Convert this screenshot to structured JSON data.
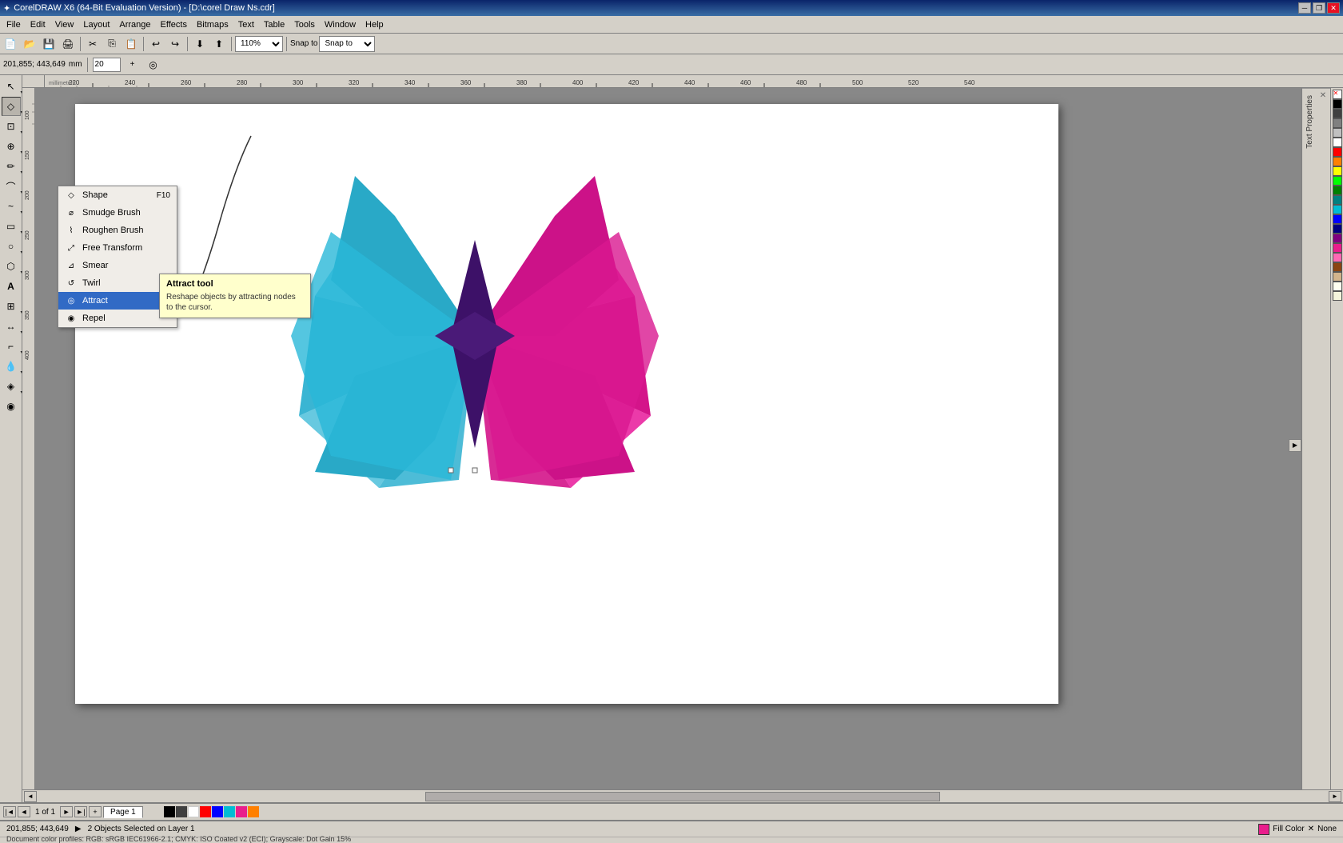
{
  "app": {
    "title": "CorelDRAW X6 (64-Bit Evaluation Version) - [D:\\corel Draw Ns.cdr]",
    "icon": "✦"
  },
  "titlebar": {
    "minimize": "─",
    "maximize": "□",
    "restore": "❐",
    "close": "✕",
    "restore_app": "❐",
    "minimize_app": "─"
  },
  "menu": {
    "items": [
      "File",
      "Edit",
      "View",
      "Layout",
      "Arrange",
      "Effects",
      "Bitmaps",
      "Text",
      "Table",
      "Tools",
      "Window",
      "Help"
    ]
  },
  "property_bar": {
    "coords": "201,855; 443,649",
    "width_label": "20",
    "snap_label": "Snap to",
    "zoom_level": "110%"
  },
  "toolbox": {
    "tools": [
      {
        "name": "select-tool",
        "icon": "↖",
        "active": false
      },
      {
        "name": "shape-tool",
        "icon": "◇",
        "active": true
      },
      {
        "name": "crop-tool",
        "icon": "⊡",
        "active": false
      },
      {
        "name": "zoom-tool",
        "icon": "🔍",
        "active": false
      },
      {
        "name": "freehand-tool",
        "icon": "✏",
        "active": false
      },
      {
        "name": "smart-draw",
        "icon": "⌒",
        "active": false
      },
      {
        "name": "artistic-media",
        "icon": "~",
        "active": false
      },
      {
        "name": "rectangle-tool",
        "icon": "▭",
        "active": false
      },
      {
        "name": "ellipse-tool",
        "icon": "○",
        "active": false
      },
      {
        "name": "polygon-tool",
        "icon": "⬡",
        "active": false
      },
      {
        "name": "text-tool",
        "icon": "A",
        "active": false
      },
      {
        "name": "table-tool",
        "icon": "⊞",
        "active": false
      },
      {
        "name": "dimension-tool",
        "icon": "↔",
        "active": false
      },
      {
        "name": "connector-tool",
        "icon": "⌐",
        "active": false
      },
      {
        "name": "color-dropper",
        "icon": "🔘",
        "active": false
      },
      {
        "name": "interactive-fill",
        "icon": "◈",
        "active": false
      },
      {
        "name": "smart-fill",
        "icon": "◉",
        "active": false
      }
    ]
  },
  "shape_dropdown": {
    "items": [
      {
        "name": "shape-item",
        "label": "Shape",
        "shortcut": "F10",
        "icon": "◇"
      },
      {
        "name": "smudge-item",
        "label": "Smudge Brush",
        "shortcut": "",
        "icon": "⌀"
      },
      {
        "name": "roughen-item",
        "label": "Roughen Brush",
        "shortcut": "",
        "icon": "⌇"
      },
      {
        "name": "free-transform-item",
        "label": "Free Transform",
        "shortcut": "",
        "icon": "⤢"
      },
      {
        "name": "smear-item",
        "label": "Smear",
        "shortcut": "",
        "icon": "⊿"
      },
      {
        "name": "twirl-item",
        "label": "Twirl",
        "shortcut": "",
        "icon": "⟳"
      },
      {
        "name": "attract-item",
        "label": "Attract",
        "shortcut": "",
        "icon": "◎",
        "selected": true
      },
      {
        "name": "repel-item",
        "label": "Repel",
        "shortcut": "",
        "icon": "◉"
      }
    ]
  },
  "tooltip": {
    "title": "Attract tool",
    "description": "Reshape objects by attracting nodes to the cursor."
  },
  "canvas": {
    "zoom": "110%",
    "page_number": "1",
    "page_total": "1",
    "page_name": "Page 1"
  },
  "status_bar": {
    "coords": "201,855; 443,649",
    "status": "2 Objects Selected on Layer 1",
    "fill_label": "Fill Color",
    "fill_color": "None",
    "profile": "Document color profiles: RGB: sRGB IEC61966-2.1; CMYK: ISO Coated v2 (ECI); Grayscale: Dot Gain 15%"
  },
  "colors": {
    "black": "#000000",
    "white": "#ffffff",
    "dark_gray": "#404040",
    "medium_gray": "#808080",
    "light_gray": "#c0c0c0",
    "red": "#ff0000",
    "cyan": "#00bcd4",
    "magenta": "#e91e8c",
    "purple": "#4a1a6b",
    "blue": "#0000ff",
    "orange": "#ff8000",
    "toolbar_bg": "#d4d0c8"
  },
  "text_properties": {
    "label": "Text Properties"
  },
  "rulers": {
    "unit": "millimeters",
    "h_marks": [
      "220",
      "240",
      "260",
      "280",
      "300",
      "320",
      "340",
      "360",
      "380",
      "400",
      "420",
      "440",
      "460",
      "480",
      "500",
      "520",
      "540"
    ],
    "v_marks": []
  }
}
